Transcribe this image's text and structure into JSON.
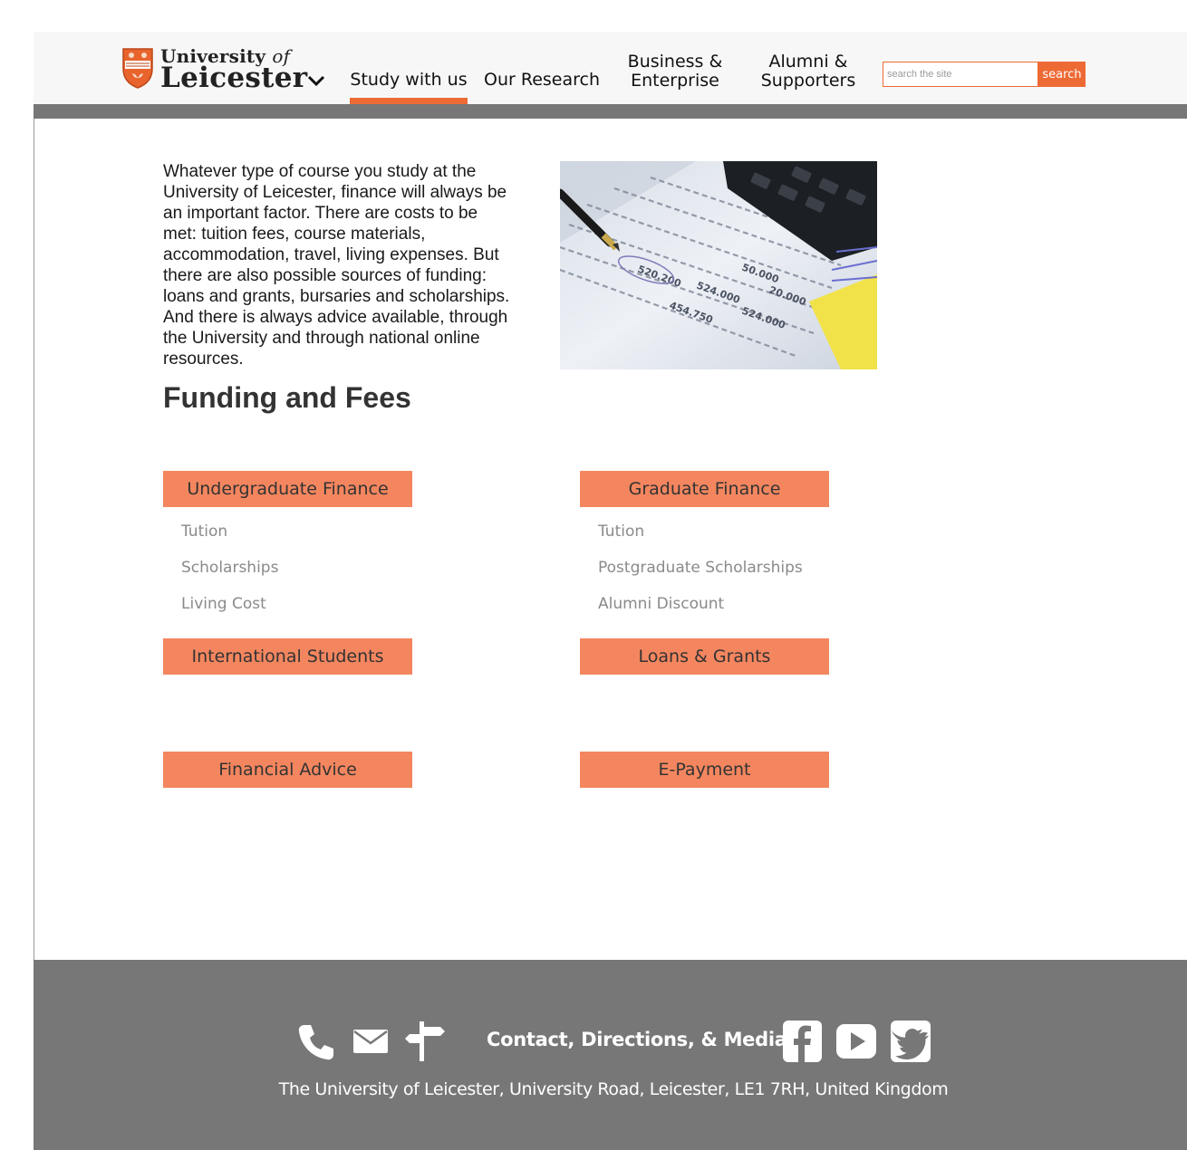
{
  "header": {
    "logo_line1": "University",
    "logo_of": "of",
    "logo_line2": "Leicester",
    "nav": [
      {
        "line1": "Study with us",
        "line2": ""
      },
      {
        "line1": "Our Research",
        "line2": ""
      },
      {
        "line1": "Business &",
        "line2": "Enterprise"
      },
      {
        "line1": "Alumni &",
        "line2": "Supporters"
      }
    ],
    "search": {
      "placeholder": "search the site",
      "button_label": "search"
    }
  },
  "colors": {
    "accent": "#ee6a35",
    "button_fill": "#f4865f",
    "footer_bg": "#777777"
  },
  "main": {
    "intro": "Whatever type of course you study at the University of Leicester, finance will always be an important factor. There are costs to be met: tuition fees, course materials, accommodation, travel, living expenses. But there are also possible sources of funding: loans and grants, bursaries and scholarships. And there is always advice available, through the University and through national online resources.",
    "title": "Funding and Fees",
    "sections": [
      {
        "label": "Undergraduate Finance",
        "links": [
          "Tution",
          "Scholarships",
          "Living Cost"
        ]
      },
      {
        "label": "Graduate Finance",
        "links": [
          "Tution",
          "Postgraduate Scholarships",
          "Alumni Discount"
        ]
      },
      {
        "label": "International Students",
        "links": []
      },
      {
        "label": "Loans & Grants",
        "links": []
      },
      {
        "label": "Financial Advice",
        "links": []
      },
      {
        "label": "E-Payment",
        "links": []
      }
    ]
  },
  "footer": {
    "icons": [
      "phone-icon",
      "mail-icon",
      "signpost-icon",
      "facebook-icon",
      "youtube-icon",
      "twitter-icon"
    ],
    "contact_label": "Contact, Directions, & Media",
    "address": "The University of Leicester, University Road, Leicester, LE1 7RH, United Kingdom"
  }
}
